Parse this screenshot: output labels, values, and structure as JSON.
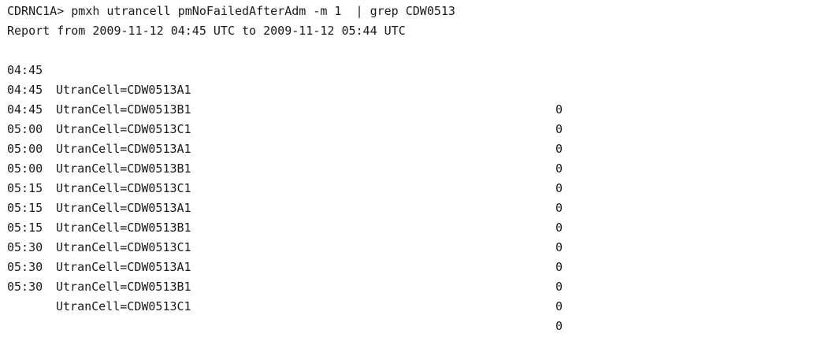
{
  "terminal": {
    "command_line": "CDRNC1A> pmxh utrancell pmNoFailedAfterAdm -m 1  | grep CDW0513",
    "report_line": "Report from 2009-11-12 04:45 UTC to 2009-11-12 05:44 UTC",
    "rows": [
      {
        "time": "04:45",
        "cell": "UtranCell=CDW0513A1",
        "value": "0"
      },
      {
        "time": "04:45",
        "cell": "UtranCell=CDW0513B1",
        "value": "0"
      },
      {
        "time": "04:45",
        "cell": "UtranCell=CDW0513C1",
        "value": "0"
      },
      {
        "time": "05:00",
        "cell": "UtranCell=CDW0513A1",
        "value": "0"
      },
      {
        "time": "05:00",
        "cell": "UtranCell=CDW0513B1",
        "value": "0"
      },
      {
        "time": "05:00",
        "cell": "UtranCell=CDW0513C1",
        "value": "0"
      },
      {
        "time": "05:15",
        "cell": "UtranCell=CDW0513A1",
        "value": "0"
      },
      {
        "time": "05:15",
        "cell": "UtranCell=CDW0513B1",
        "value": "0"
      },
      {
        "time": "05:15",
        "cell": "UtranCell=CDW0513C1",
        "value": "0"
      },
      {
        "time": "05:30",
        "cell": "UtranCell=CDW0513A1",
        "value": "0"
      },
      {
        "time": "05:30",
        "cell": "UtranCell=CDW0513B1",
        "value": "0"
      },
      {
        "time": "05:30",
        "cell": "UtranCell=CDW0513C1",
        "value": "0"
      }
    ]
  }
}
